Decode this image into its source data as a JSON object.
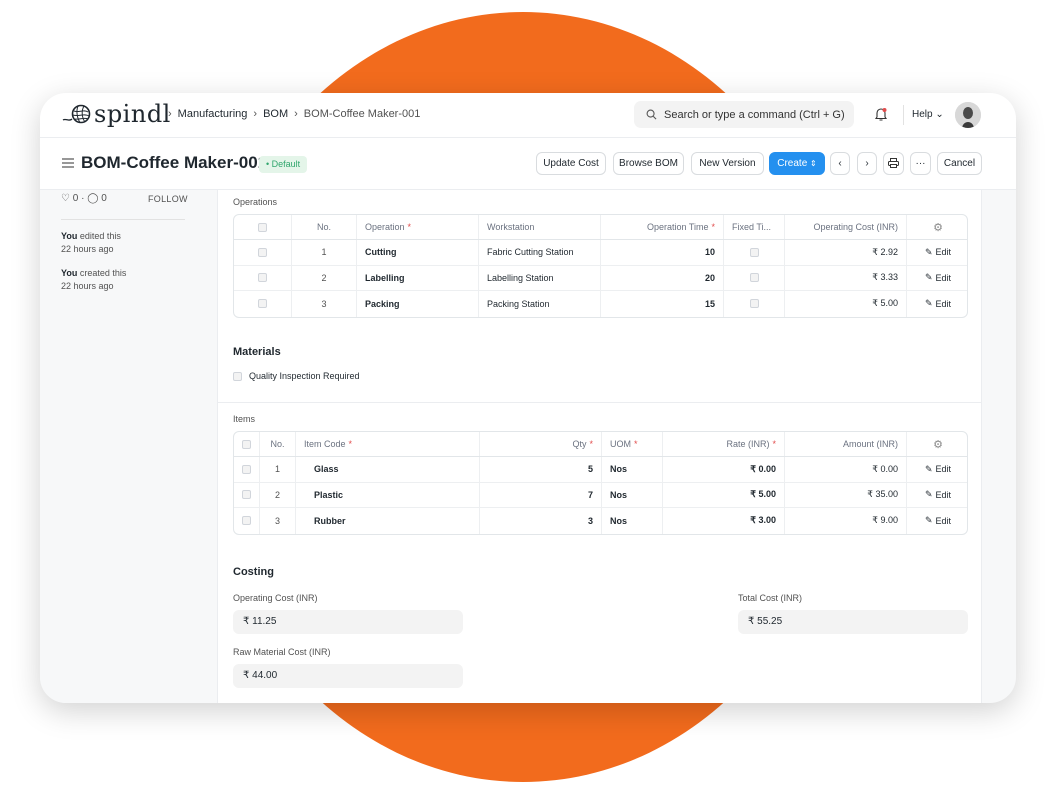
{
  "app": {
    "logo_text": "spindl"
  },
  "breadcrumb": {
    "items": [
      "Manufacturing",
      "BOM",
      "BOM-Coffee Maker-001"
    ]
  },
  "search": {
    "placeholder": "Search or type a command (Ctrl + G)"
  },
  "nav": {
    "help_label": "Help"
  },
  "page": {
    "title": "BOM-Coffee Maker-001",
    "status_badge": "Default",
    "buttons": {
      "update_cost": "Update Cost",
      "browse_bom": "Browse BOM",
      "new_version": "New Version",
      "create": "Create",
      "more": "···",
      "cancel": "Cancel"
    }
  },
  "sidebar": {
    "likes": "0",
    "comments": "0",
    "follow_label": "FOLLOW",
    "activity": [
      {
        "who": "You",
        "action": "edited this",
        "when": "22 hours ago"
      },
      {
        "who": "You",
        "action": "created this",
        "when": "22 hours ago"
      }
    ]
  },
  "operations": {
    "label": "Operations",
    "columns": [
      "No.",
      "Operation",
      "Workstation",
      "Operation Time",
      "Fixed Ti...",
      "Operating Cost (INR)"
    ],
    "rows": [
      {
        "no": "1",
        "operation": "Cutting",
        "workstation": "Fabric Cutting Station",
        "time": "10",
        "cost": "₹ 2.92",
        "edit": "Edit"
      },
      {
        "no": "2",
        "operation": "Labelling",
        "workstation": "Labelling Station",
        "time": "20",
        "cost": "₹ 3.33",
        "edit": "Edit"
      },
      {
        "no": "3",
        "operation": "Packing",
        "workstation": "Packing Station",
        "time": "15",
        "cost": "₹ 5.00",
        "edit": "Edit"
      }
    ]
  },
  "materials": {
    "heading": "Materials",
    "quality_inspection_label": "Quality Inspection Required",
    "items_label": "Items",
    "columns": [
      "No.",
      "Item Code",
      "Qty",
      "UOM",
      "Rate (INR)",
      "Amount (INR)"
    ],
    "rows": [
      {
        "no": "1",
        "item_code": "Glass",
        "qty": "5",
        "uom": "Nos",
        "rate": "₹ 0.00",
        "amount": "₹ 0.00",
        "edit": "Edit"
      },
      {
        "no": "2",
        "item_code": "Plastic",
        "qty": "7",
        "uom": "Nos",
        "rate": "₹ 5.00",
        "amount": "₹ 35.00",
        "edit": "Edit"
      },
      {
        "no": "3",
        "item_code": "Rubber",
        "qty": "3",
        "uom": "Nos",
        "rate": "₹ 3.00",
        "amount": "₹ 9.00",
        "edit": "Edit"
      }
    ]
  },
  "costing": {
    "heading": "Costing",
    "operating_cost_label": "Operating Cost (INR)",
    "operating_cost_value": "₹ 11.25",
    "total_cost_label": "Total Cost (INR)",
    "total_cost_value": "₹ 55.25",
    "raw_material_cost_label": "Raw Material Cost (INR)",
    "raw_material_cost_value": "₹ 44.00"
  },
  "colors": {
    "accent_orange": "#f26b1d",
    "primary_blue": "#2490ef",
    "badge_green": "#30a66d"
  }
}
